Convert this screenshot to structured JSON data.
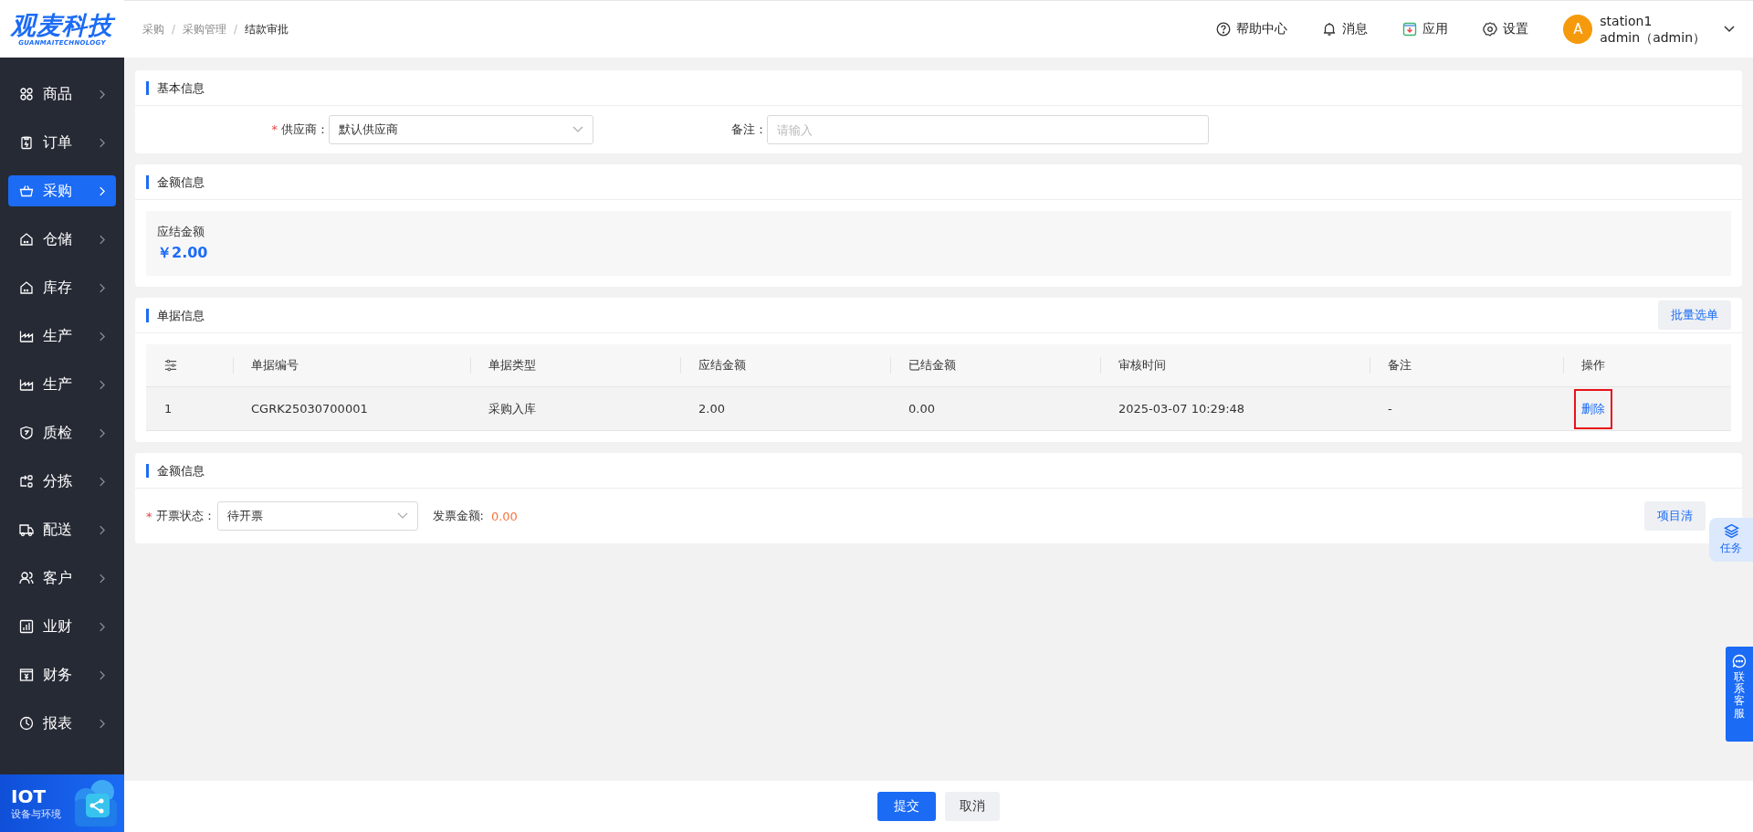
{
  "logo": {
    "title": "观麦科技",
    "subtitle": "GUANMAITECHNOLOGY"
  },
  "breadcrumb": [
    "采购",
    "采购管理",
    "结款审批"
  ],
  "breadcrumb_separator": "/",
  "header": {
    "links": [
      {
        "label": "帮助中心"
      },
      {
        "label": "消息"
      },
      {
        "label": "应用"
      },
      {
        "label": "设置"
      }
    ],
    "user": {
      "avatar": "A",
      "station": "station1",
      "name": "admin（admin）"
    }
  },
  "sidebar": {
    "items": [
      {
        "label": "商品",
        "selected": false
      },
      {
        "label": "订单",
        "selected": false
      },
      {
        "label": "采购",
        "selected": true
      },
      {
        "label": "仓储",
        "selected": false
      },
      {
        "label": "库存",
        "selected": false
      },
      {
        "label": "生产",
        "selected": false
      },
      {
        "label": "生产",
        "selected": false
      },
      {
        "label": "质检",
        "selected": false
      },
      {
        "label": "分拣",
        "selected": false
      },
      {
        "label": "配送",
        "selected": false
      },
      {
        "label": "客户",
        "selected": false
      },
      {
        "label": "业财",
        "selected": false
      },
      {
        "label": "财务",
        "selected": false
      },
      {
        "label": "报表",
        "selected": false
      }
    ],
    "banner": {
      "title": "IOT",
      "subtitle": "设备与环境"
    }
  },
  "basic": {
    "title": "基本信息",
    "supplier": {
      "required_mark": "*",
      "label": "供应商：",
      "value": "默认供应商"
    },
    "remark": {
      "label": "备注：",
      "placeholder": "请输入"
    }
  },
  "amount": {
    "title": "金额信息",
    "label": "应结金额",
    "value": "￥2.00"
  },
  "documents": {
    "title": "单据信息",
    "button": "批量选单",
    "columns": [
      "单据编号",
      "单据类型",
      "应结金额",
      "已结金额",
      "审核时间",
      "备注",
      "操作"
    ],
    "rows": [
      {
        "index": "1",
        "number": "CGRK25030700001",
        "type": "采购入库",
        "due": "2.00",
        "settled": "0.00",
        "time": "2025-03-07 10:29:48",
        "remark": "-",
        "action": "删除",
        "highlighted": true
      }
    ]
  },
  "invoice": {
    "title": "金额信息",
    "status": {
      "required_mark": "*",
      "label": "开票状态：",
      "value": "待开票"
    },
    "amount_label": "发票金额:",
    "amount": "0.00",
    "button": "项目清"
  },
  "float": {
    "task": "任务",
    "service": "联系客服"
  },
  "footer": {
    "submit": "提交",
    "cancel": "取消"
  }
}
